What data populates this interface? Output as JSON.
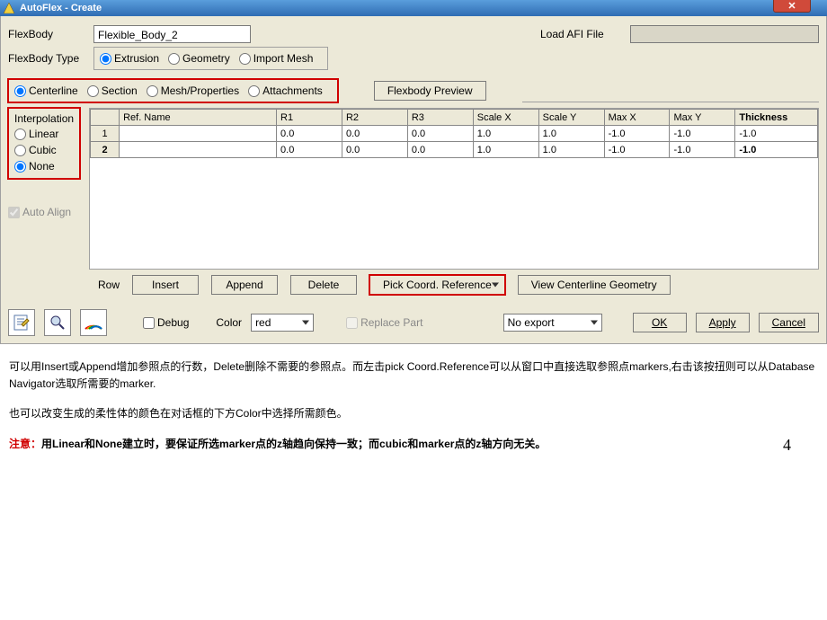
{
  "window": {
    "title": "AutoFlex - Create"
  },
  "form": {
    "flexbody_label": "FlexBody",
    "flexbody_value": "Flexible_Body_2",
    "load_afi_label": "Load AFI File",
    "flexbody_type_label": "FlexBody Type",
    "type_options": {
      "extrusion": "Extrusion",
      "geometry": "Geometry",
      "import_mesh": "Import Mesh"
    },
    "view_options": {
      "centerline": "Centerline",
      "section": "Section",
      "mesh": "Mesh/Properties",
      "attachments": "Attachments"
    },
    "flexbody_preview": "Flexbody Preview"
  },
  "interp": {
    "label": "Interpolation",
    "linear": "Linear",
    "cubic": "Cubic",
    "none": "None",
    "auto_align": "Auto Align"
  },
  "grid": {
    "headers": [
      "",
      "Ref. Name",
      "R1",
      "R2",
      "R3",
      "Scale X",
      "Scale Y",
      "Max X",
      "Max Y",
      "Thickness"
    ],
    "rows": [
      {
        "n": "1",
        "ref": "",
        "r1": "0.0",
        "r2": "0.0",
        "r3": "0.0",
        "sx": "1.0",
        "sy": "1.0",
        "mx": "-1.0",
        "my": "-1.0",
        "th": "-1.0"
      },
      {
        "n": "2",
        "ref": "",
        "r1": "0.0",
        "r2": "0.0",
        "r3": "0.0",
        "sx": "1.0",
        "sy": "1.0",
        "mx": "-1.0",
        "my": "-1.0",
        "th": "-1.0"
      }
    ]
  },
  "rowops": {
    "label": "Row",
    "insert": "Insert",
    "append": "Append",
    "delete": "Delete",
    "pick": "Pick Coord. Reference",
    "view_geom": "View Centerline Geometry"
  },
  "bottom": {
    "debug": "Debug",
    "color_label": "Color",
    "color_value": "red",
    "replace_part": "Replace Part",
    "export_value": "No export",
    "ok": "OK",
    "apply": "Apply",
    "cancel": "Cancel"
  },
  "doc": {
    "p1": "可以用Insert或Append增加参照点的行数，Delete删除不需要的参照点。而左击pick Coord.Reference可以从窗口中直接选取参照点markers,右击该按扭则可以从Database Navigator选取所需要的marker.",
    "p2": "也可以改变生成的柔性体的颜色在对话框的下方Color中选择所需颜色。",
    "p3_warn": "注意：",
    "p3_rest": "用Linear和None建立时，要保证所选marker点的z轴趋向保持一致；而cubic和marker点的z轴方向无关。",
    "page": "4"
  }
}
